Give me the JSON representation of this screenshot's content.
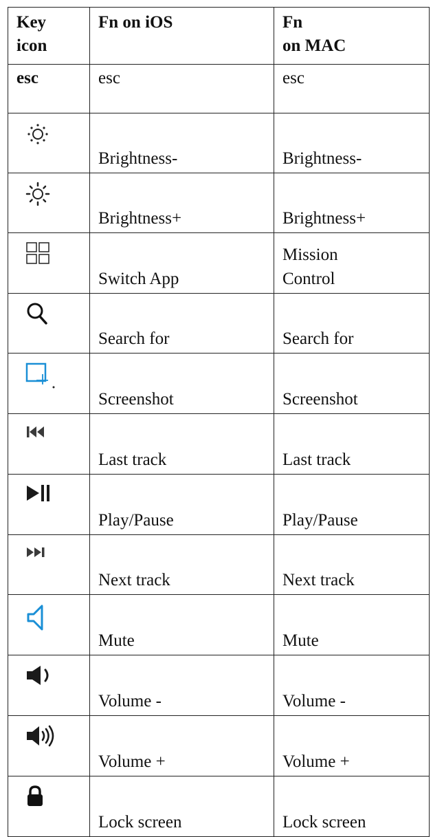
{
  "table": {
    "headers": {
      "key_icon": [
        "Key",
        "icon"
      ],
      "fn_ios": "Fn on iOS",
      "fn_mac": [
        "Fn",
        "on MAC"
      ]
    },
    "rows": [
      {
        "key": "esc",
        "icon": "",
        "ios": "esc",
        "mac": "esc"
      },
      {
        "icon": "brightness-low-icon",
        "ios": "Brightness-",
        "mac": "Brightness-"
      },
      {
        "icon": "brightness-high-icon",
        "ios": "Brightness+",
        "mac": "Brightness+"
      },
      {
        "icon": "mission-control-grid-icon",
        "ios": "Switch App",
        "mac": [
          "Mission",
          "Control"
        ]
      },
      {
        "icon": "search-icon",
        "ios": "Search for",
        "mac": "Search for"
      },
      {
        "icon": "screenshot-icon",
        "ios": "Screenshot",
        "mac": "Screenshot"
      },
      {
        "icon": "previous-track-icon",
        "ios": "Last track",
        "mac": "Last track"
      },
      {
        "icon": "play-pause-icon",
        "ios": "Play/Pause",
        "mac": "Play/Pause"
      },
      {
        "icon": "next-track-icon",
        "ios": "Next track",
        "mac": "Next track"
      },
      {
        "icon": "mute-icon",
        "ios": "Mute",
        "mac": "Mute"
      },
      {
        "icon": "volume-down-icon",
        "ios": "Volume -",
        "mac": "Volume -"
      },
      {
        "icon": "volume-up-icon",
        "ios": "Volume +",
        "mac": "Volume +"
      },
      {
        "icon": "lock-icon",
        "ios": "Lock screen",
        "mac": "Lock screen"
      }
    ]
  },
  "colors": {
    "border": "#222222",
    "text": "#111111",
    "icon_dark": "#222222",
    "icon_blue": "#1a8fd6"
  }
}
